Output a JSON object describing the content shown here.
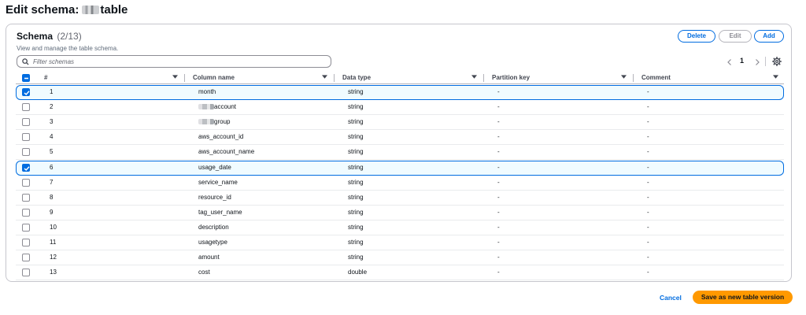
{
  "page": {
    "title_prefix": "Edit schema:",
    "title_suffix": "table"
  },
  "schema_panel": {
    "title": "Schema",
    "count": "(2/13)",
    "description": "View and manage the table schema.",
    "search_placeholder": "Filter schemas",
    "current_page": "1",
    "buttons": {
      "delete": "Delete",
      "edit": "Edit",
      "add": "Add"
    },
    "columns": [
      "#",
      "Column name",
      "Data type",
      "Partition key",
      "Comment"
    ],
    "rows": [
      {
        "num": "1",
        "name": "month",
        "type": "string",
        "partition": "-",
        "comment": "-",
        "selected": true
      },
      {
        "num": "2",
        "name": "account",
        "type": "string",
        "partition": "-",
        "comment": "-",
        "selected": false,
        "redacted_prefix": true
      },
      {
        "num": "3",
        "name": "group",
        "type": "string",
        "partition": "-",
        "comment": "-",
        "selected": false,
        "redacted_prefix": true
      },
      {
        "num": "4",
        "name": "aws_account_id",
        "type": "string",
        "partition": "-",
        "comment": "-",
        "selected": false
      },
      {
        "num": "5",
        "name": "aws_account_name",
        "type": "string",
        "partition": "-",
        "comment": "-",
        "selected": false
      },
      {
        "num": "6",
        "name": "usage_date",
        "type": "string",
        "partition": "-",
        "comment": "-",
        "selected": true
      },
      {
        "num": "7",
        "name": "service_name",
        "type": "string",
        "partition": "-",
        "comment": "-",
        "selected": false
      },
      {
        "num": "8",
        "name": "resource_id",
        "type": "string",
        "partition": "-",
        "comment": "-",
        "selected": false
      },
      {
        "num": "9",
        "name": "tag_user_name",
        "type": "string",
        "partition": "-",
        "comment": "-",
        "selected": false
      },
      {
        "num": "10",
        "name": "description",
        "type": "string",
        "partition": "-",
        "comment": "-",
        "selected": false
      },
      {
        "num": "11",
        "name": "usagetype",
        "type": "string",
        "partition": "-",
        "comment": "-",
        "selected": false
      },
      {
        "num": "12",
        "name": "amount",
        "type": "string",
        "partition": "-",
        "comment": "-",
        "selected": false
      },
      {
        "num": "13",
        "name": "cost",
        "type": "double",
        "partition": "-",
        "comment": "-",
        "selected": false
      }
    ]
  },
  "footer": {
    "cancel": "Cancel",
    "save": "Save as new table version"
  },
  "colors": {
    "accent": "#006ce0",
    "primary_button": "#ff9900",
    "selected_row_bg": "#f0fbff"
  }
}
